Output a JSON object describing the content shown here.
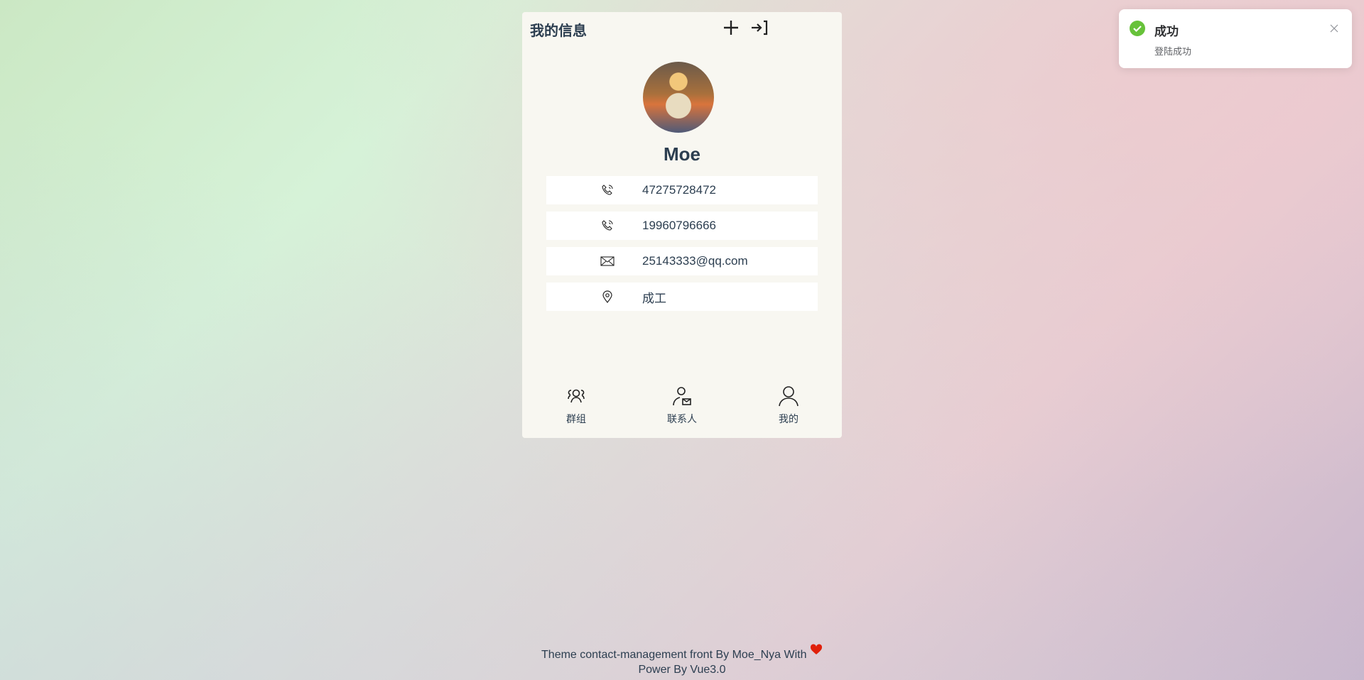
{
  "header": {
    "title": "我的信息",
    "add_icon": "plus-icon",
    "logout_icon": "sign-in-arrow-icon"
  },
  "profile": {
    "name": "Moe",
    "avatar": "anime-avatar",
    "fields": [
      {
        "icon": "phone-icon",
        "value": "47275728472"
      },
      {
        "icon": "phone-icon",
        "value": "19960796666"
      },
      {
        "icon": "mail-icon",
        "value": "25143333@qq.com"
      },
      {
        "icon": "location-icon",
        "value": "成工"
      }
    ]
  },
  "nav": [
    {
      "label": "群组",
      "icon": "group-icon"
    },
    {
      "label": "联系人",
      "icon": "contact-icon"
    },
    {
      "label": "我的",
      "icon": "user-icon"
    }
  ],
  "toast": {
    "title": "成功",
    "message": "登陆成功",
    "color": "#67c23a"
  },
  "footer": {
    "line1": "Theme contact-management front By Moe_Nya With",
    "line2": "Power By Vue3.0",
    "heart_color": "#e0200a"
  }
}
